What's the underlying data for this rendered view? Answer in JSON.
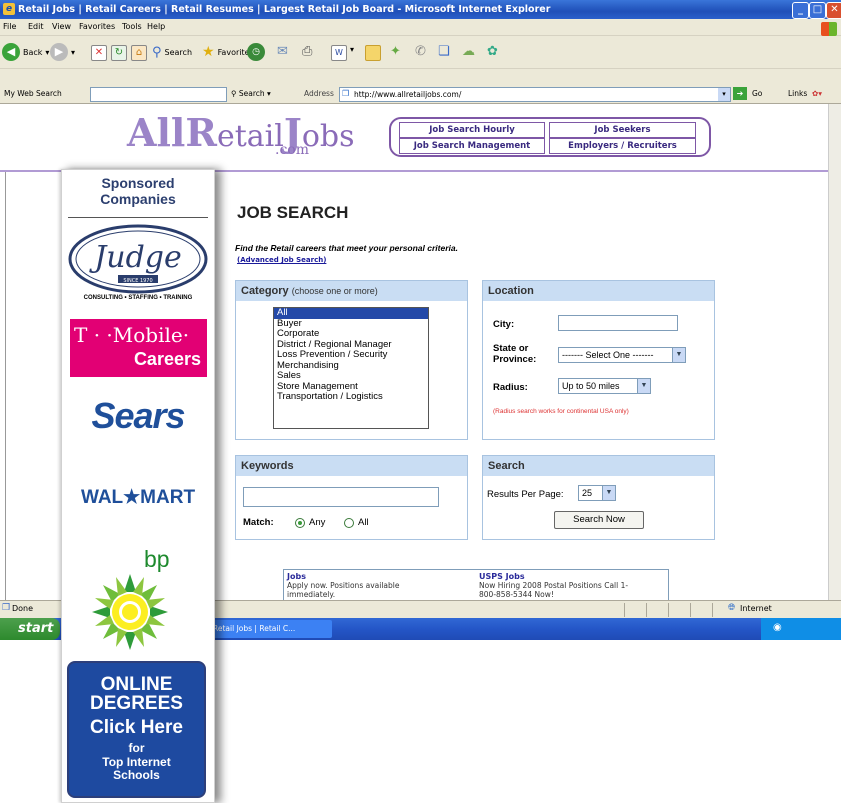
{
  "window": {
    "title": "Retail Jobs | Retail Careers | Retail Resumes | Largest Retail Job Board - Microsoft Internet Explorer",
    "menu": [
      "File",
      "Edit",
      "View",
      "Favorites",
      "Tools",
      "Help"
    ],
    "toolbar": {
      "back": "Back",
      "search": "Search",
      "favorites": "Favorites"
    },
    "my_web_search": "My Web Search",
    "search_label": "Search",
    "address_label": "Address",
    "url": "http://www.allretailjobs.com/",
    "go": "Go",
    "links": "Links",
    "status_left": "Done",
    "status_zone": "Internet",
    "start": "start",
    "task_item": "Retail Jobs | Retail C..."
  },
  "site": {
    "logo": {
      "a": "All",
      "r": "R",
      "etail": "etail",
      "j": "J",
      "obs": "obs",
      "com": ".com"
    },
    "nav": [
      "Job Search Hourly",
      "Job Seekers",
      "Job Search Management",
      "Employers / Recruiters"
    ]
  },
  "page": {
    "title": "JOB SEARCH",
    "subtitle": "Find the Retail careers that meet your personal criteria.",
    "advanced_link": "(Advanced Job Search)",
    "category": {
      "heading": "Category",
      "heading_note": "(choose one or more)",
      "options": [
        "All",
        "Buyer",
        "Corporate",
        "District / Regional Manager",
        "Loss Prevention / Security",
        "Merchandising",
        "Sales",
        "Store Management",
        "Transportation / Logistics"
      ],
      "selected": "All"
    },
    "location": {
      "heading": "Location",
      "city_label": "City:",
      "state_label": "State or Province:",
      "state_value": "------- Select One -------",
      "radius_label": "Radius:",
      "radius_value": "Up to 50 miles",
      "note": "(Radius search works for continental USA only)"
    },
    "keywords": {
      "heading": "Keywords",
      "match_label": "Match:",
      "any": "Any",
      "all": "All"
    },
    "search": {
      "heading": "Search",
      "results_label": "Results Per Page:",
      "results_value": "25",
      "button": "Search Now"
    },
    "ads": [
      {
        "title": "Jobs",
        "line1": "Apply now. Positions available",
        "line2": "immediately."
      },
      {
        "title": "USPS Jobs",
        "line1": "Now Hiring 2008 Postal Positions Call 1-",
        "line2": "800-858-5344 Now!"
      }
    ]
  },
  "sidebar": {
    "title": "Sponsored Companies",
    "judge": {
      "name": "Judge",
      "since": "SINCE 1970",
      "tagline": "CONSULTING • STAFFING • TRAINING"
    },
    "tmobile": {
      "line1": "T · ·Mobile·",
      "line2": "Careers"
    },
    "sears": "Sears",
    "walmart": "WAL★MART",
    "bp": "bp",
    "degrees": {
      "line1": "ONLINE",
      "line2": "DEGREES",
      "line3": "Click Here",
      "line4": "for",
      "line5": "Top Internet",
      "line6": "Schools"
    }
  }
}
